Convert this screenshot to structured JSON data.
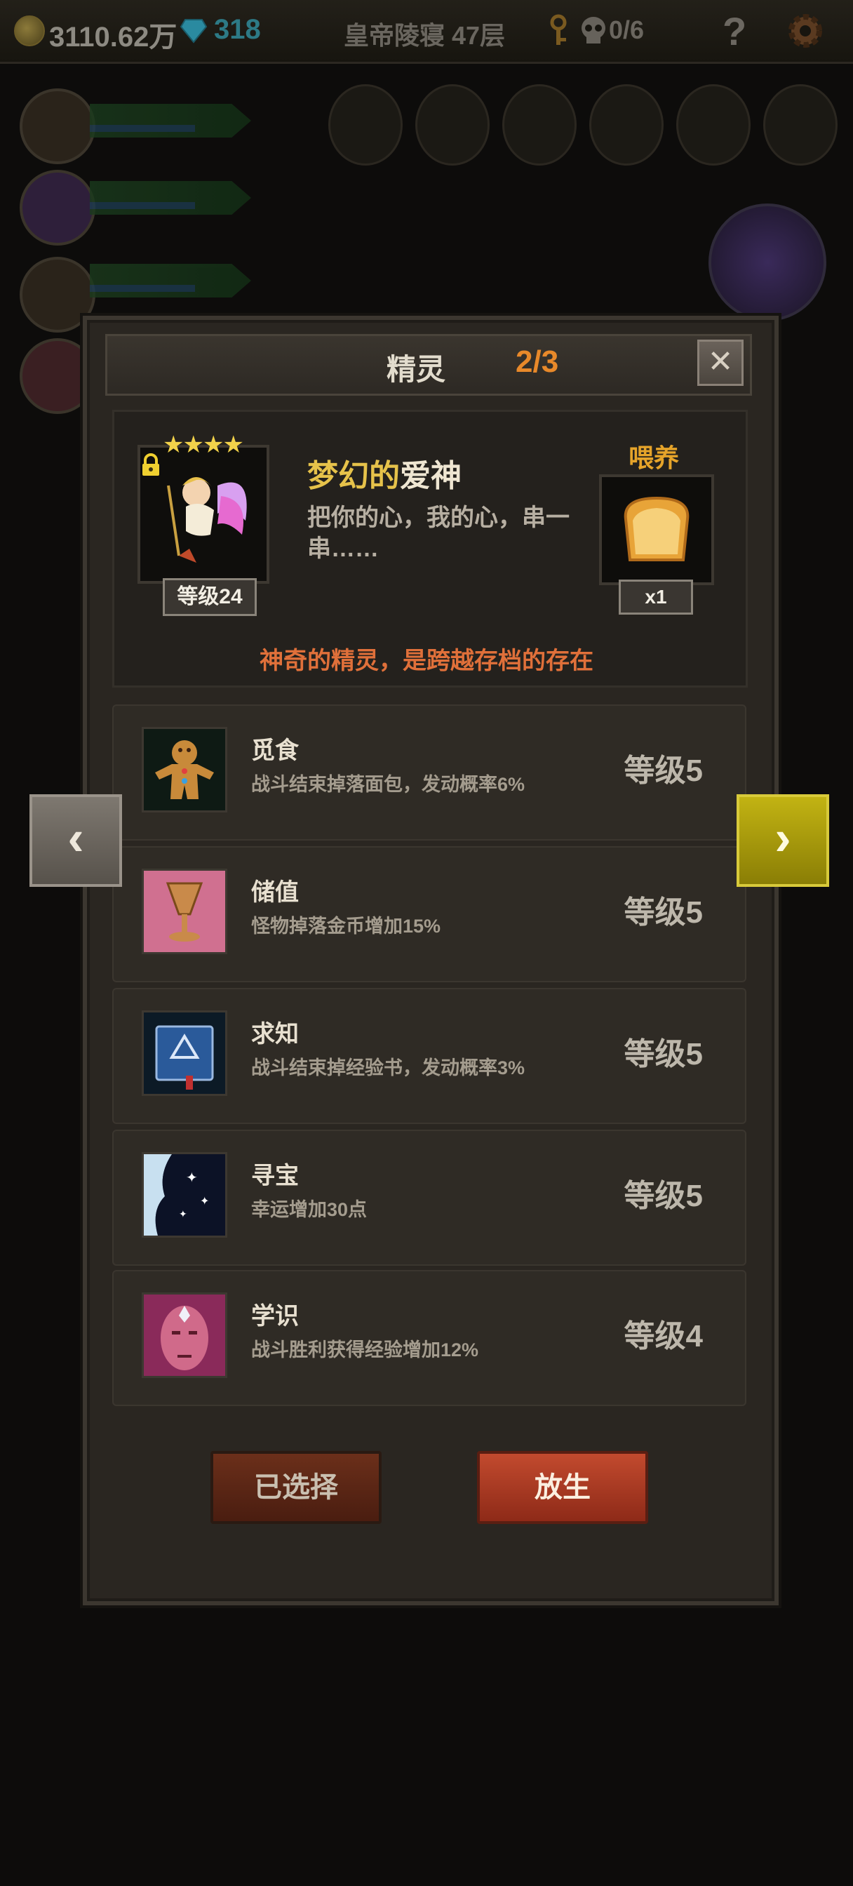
{
  "topbar": {
    "gold": "3110.62万",
    "gems": "318",
    "location": "皇帝陵寝 47层",
    "skull_count": "0/6",
    "help": "?"
  },
  "dialog": {
    "title": "精灵",
    "page": "2/3",
    "close": "✕",
    "spirit": {
      "stars": "★★★★",
      "name_part1": "梦幻的",
      "name_part2": "爱神",
      "description": "把你的心，我的心，串一串……",
      "level": "等级24"
    },
    "feed": {
      "label": "喂养",
      "count": "x1"
    },
    "tagline": "神奇的精灵，是跨越存档的存在",
    "skills": [
      {
        "name": "觅食",
        "desc": "战斗结束掉落面包，发动概率6%",
        "level": "等级5",
        "icon": "gingerbread-icon"
      },
      {
        "name": "储值",
        "desc": "怪物掉落金币增加15%",
        "level": "等级5",
        "icon": "goblet-icon"
      },
      {
        "name": "求知",
        "desc": "战斗结束掉经验书，发动概率3%",
        "level": "等级5",
        "icon": "book-icon"
      },
      {
        "name": "寻宝",
        "desc": "幸运增加30点",
        "level": "等级5",
        "icon": "silhouette-stars-icon"
      },
      {
        "name": "学识",
        "desc": "战斗胜利获得经验增加12%",
        "level": "等级4",
        "icon": "face-gem-icon"
      }
    ],
    "buttons": {
      "selected": "已选择",
      "release": "放生"
    }
  },
  "nav": {
    "prev": "‹",
    "next": "›"
  },
  "colors": {
    "accent_orange": "#e8892a",
    "gold_text": "#e6c24a",
    "release_red": "#c24a2e",
    "next_yellow": "#c2b313"
  }
}
